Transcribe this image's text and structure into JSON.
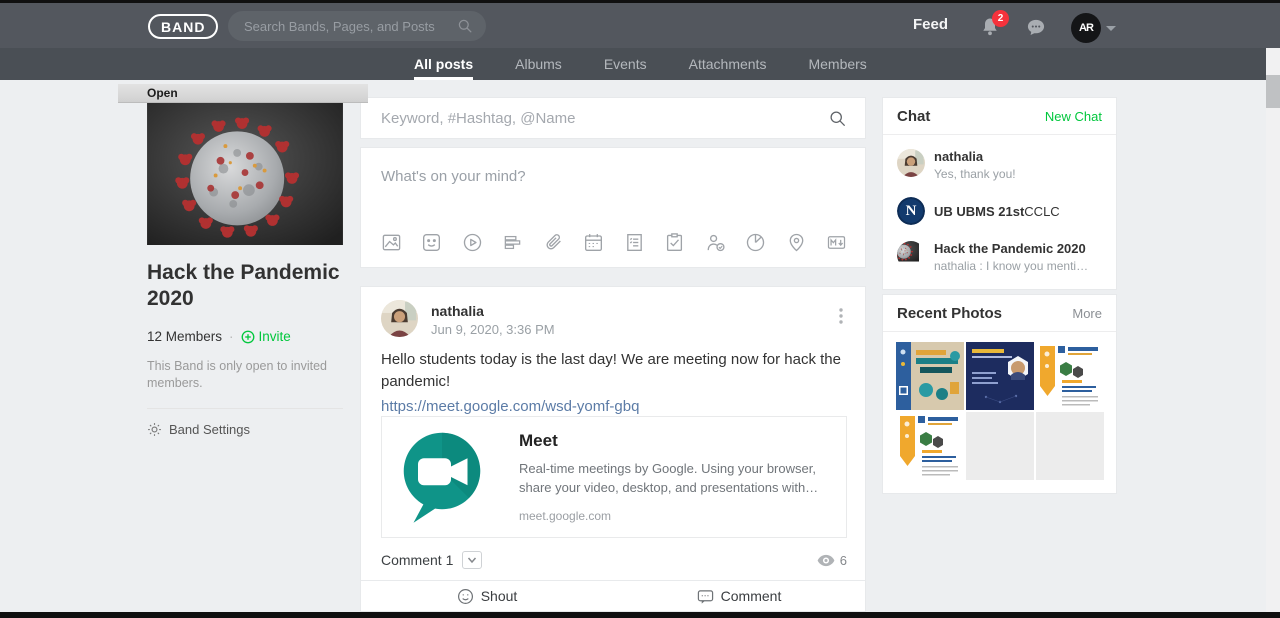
{
  "browser": {
    "open_label": "Open"
  },
  "navbar": {
    "logo": "BAND",
    "search_placeholder": "Search Bands, Pages, and Posts",
    "feed_label": "Feed",
    "notification_count": "2",
    "avatar_initials": "AR"
  },
  "tabs": {
    "items": [
      {
        "label": "All posts",
        "active": true
      },
      {
        "label": "Albums",
        "active": false
      },
      {
        "label": "Events",
        "active": false
      },
      {
        "label": "Attachments",
        "active": false
      },
      {
        "label": "Members",
        "active": false
      }
    ]
  },
  "band": {
    "title": "Hack the Pandemic 2020",
    "members_label": "12 Members",
    "separator": "·",
    "invite_label": "Invite",
    "privacy_note": "This Band is only open to invited members.",
    "settings_label": "Band Settings"
  },
  "feed": {
    "search_placeholder": "Keyword, #Hashtag, @Name",
    "composer": {
      "placeholder": "What's on your mind?",
      "icons": [
        "photo",
        "sticker",
        "video",
        "poll-format",
        "file-attach",
        "calendar",
        "note",
        "todo",
        "attendance-check",
        "chart",
        "location",
        "markdown"
      ]
    },
    "post": {
      "author": "nathalia",
      "timestamp": "Jun 9, 2020, 3:36 PM",
      "body": "Hello students today is the last day! We are meeting now for hack the pandemic!",
      "link": "https://meet.google.com/wsd-yomf-gbq",
      "preview": {
        "title": "Meet",
        "description": "Real-time meetings by Google. Using your browser, share your video, desktop, and presentations with…",
        "domain": "meet.google.com"
      },
      "comment_count_label": "Comment 1",
      "view_count": "6",
      "shout_label": "Shout",
      "comment_action_label": "Comment"
    }
  },
  "chat": {
    "title": "Chat",
    "new_chat_label": "New Chat",
    "items": [
      {
        "name": "nathalia",
        "name_suffix": "",
        "message": "Yes, thank you!"
      },
      {
        "name": "UB UBMS 21st",
        "name_suffix": "CCLC",
        "message": ""
      },
      {
        "name": "Hack the Pandemic 2020",
        "name_suffix": "",
        "message": "nathalia : I know you mentione…"
      }
    ],
    "ub_avatar_letter": "N"
  },
  "photos": {
    "title": "Recent Photos",
    "more_label": "More"
  },
  "colors": {
    "accent_green": "#00c73c",
    "badge_red": "#f5323c",
    "link_blue": "#5b7ba6",
    "meet_teal": "#0f9488",
    "navbar_gray": "#53575e",
    "tabbar_gray": "#4a4f55"
  }
}
